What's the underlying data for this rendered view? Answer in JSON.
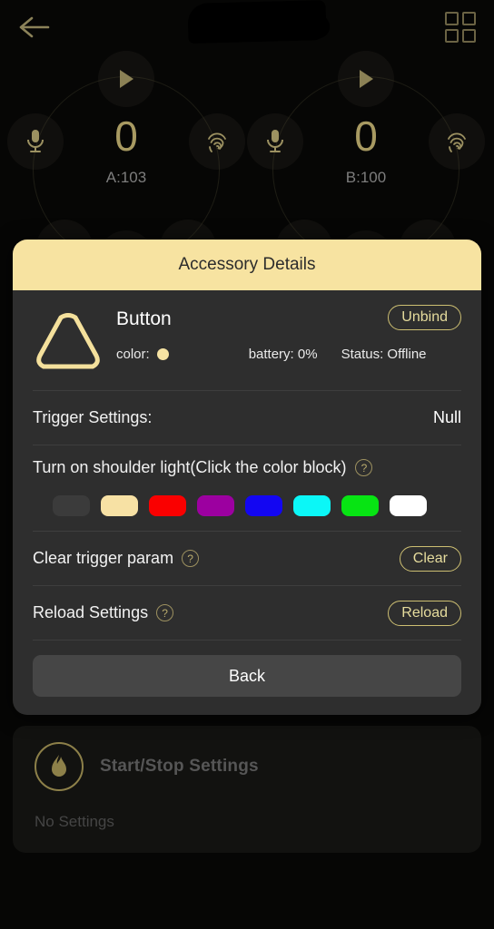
{
  "topbar": {
    "back_icon": "arrow-left-icon",
    "grid_icon": "grid-view-icon",
    "title_redacted": ""
  },
  "dials": [
    {
      "id": "A",
      "count": "0",
      "label": "A:103",
      "nodes": [
        "play-icon",
        "microphone-icon",
        "fingerprint-icon"
      ]
    },
    {
      "id": "B",
      "count": "0",
      "label": "B:100",
      "nodes": [
        "play-icon",
        "microphone-icon",
        "fingerprint-icon"
      ]
    }
  ],
  "bottom_card": {
    "icon": "flame-icon",
    "title": "Start/Stop Settings",
    "subtitle": "No Settings"
  },
  "modal": {
    "header_title": "Accessory Details",
    "header_bg": "#f7e3a1",
    "accessory": {
      "shape_icon": "rounded-triangle-icon",
      "name": "Button",
      "color_label": "color:",
      "color_value": "#f6e3a3",
      "battery": "battery: 0%",
      "status": "Status: Offline",
      "unbind_label": "Unbind"
    },
    "trigger": {
      "label": "Trigger Settings:",
      "value": "Null"
    },
    "shoulder_light": {
      "label": "Turn on shoulder light(Click the color block)",
      "help_icon": "question-mark-icon",
      "swatches": [
        {
          "name": "off",
          "hex": "#3b3b3b"
        },
        {
          "name": "cream",
          "hex": "#f7e1a4"
        },
        {
          "name": "red",
          "hex": "#fa0000"
        },
        {
          "name": "purple",
          "hex": "#9c00a0"
        },
        {
          "name": "blue",
          "hex": "#1306f2"
        },
        {
          "name": "cyan",
          "hex": "#0bf7f7"
        },
        {
          "name": "green",
          "hex": "#07e413"
        },
        {
          "name": "white",
          "hex": "#ffffff"
        }
      ]
    },
    "clear_trigger": {
      "label": "Clear trigger param",
      "help_icon": "question-mark-icon",
      "button": "Clear"
    },
    "reload": {
      "label": "Reload Settings",
      "help_icon": "question-mark-icon",
      "button": "Reload"
    },
    "back_button": "Back"
  }
}
